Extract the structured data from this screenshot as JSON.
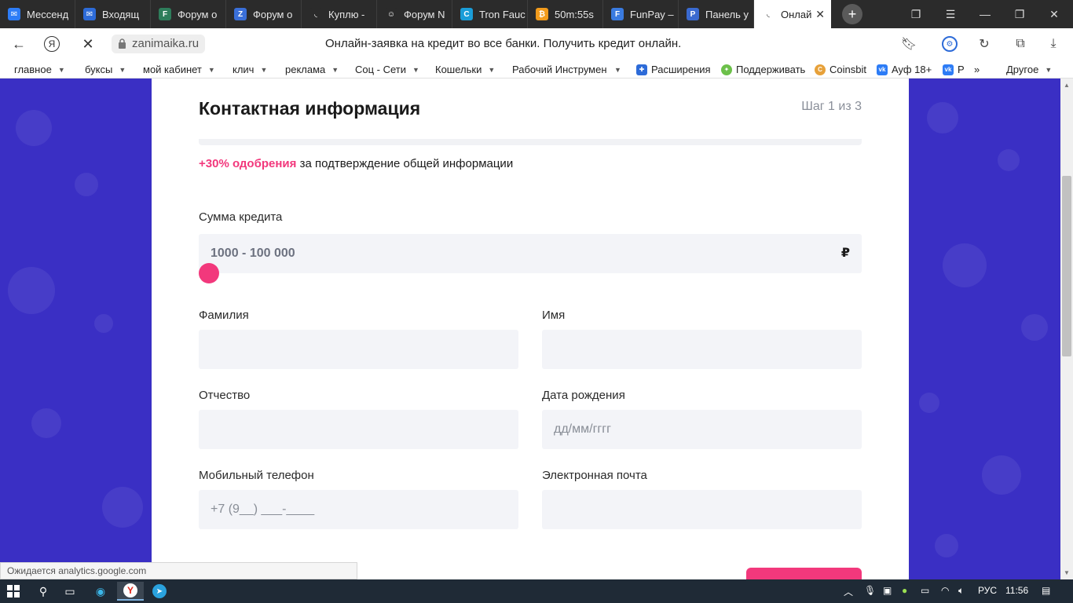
{
  "browser": {
    "tabs": [
      {
        "title": "Мессенд",
        "icon": "messenger-icon",
        "color": "#2d7cf6",
        "glyph": "✉"
      },
      {
        "title": "Входящ",
        "icon": "mail-icon",
        "color": "#2d6bd8",
        "glyph": "✉"
      },
      {
        "title": "Форум о",
        "icon": "forum-icon",
        "color": "#2e7d5b",
        "glyph": "F"
      },
      {
        "title": "Форум о",
        "icon": "zeta-forum-icon",
        "color": "#3a6fd8",
        "glyph": "Z"
      },
      {
        "title": "Куплю -",
        "icon": "loading-icon",
        "color": "#2b2b2b",
        "glyph": "◟"
      },
      {
        "title": "Форум N",
        "icon": "cat-forum-icon",
        "color": "#2b2b2b",
        "glyph": "☺"
      },
      {
        "title": "Tron Fauc",
        "icon": "tron-icon",
        "color": "#1a9dd8",
        "glyph": "C"
      },
      {
        "title": "50m:55s",
        "icon": "bitcoin-icon",
        "color": "#f29b1c",
        "glyph": "₿"
      },
      {
        "title": "FunPay –",
        "icon": "funpay-icon",
        "color": "#3a7be0",
        "glyph": "F"
      },
      {
        "title": "Панель у",
        "icon": "panel-icon",
        "color": "#3a6ad0",
        "glyph": "P"
      },
      {
        "title": "Онлай",
        "icon": "loading-icon",
        "color": "#ffffff",
        "glyph": "◟",
        "active": true
      }
    ],
    "url": "zanimaika.ru",
    "page_title": "Онлайн-заявка на кредит во все банки. Получить кредит онлайн.",
    "bookmarks": [
      {
        "label": "главное",
        "dropdown": true
      },
      {
        "label": "буксы",
        "dropdown": true
      },
      {
        "label": "мой кабинет",
        "dropdown": true
      },
      {
        "label": "клич",
        "dropdown": true
      },
      {
        "label": "реклама",
        "dropdown": true
      },
      {
        "label": "Соц - Сети",
        "dropdown": true
      },
      {
        "label": "Кошельки",
        "dropdown": true
      },
      {
        "label": "Рабочий Инструмен",
        "dropdown": true
      },
      {
        "label": "Расширения",
        "icon": "puzzle-icon"
      },
      {
        "label": "Поддерживать",
        "icon": "lightbulb-icon"
      },
      {
        "label": "Coinsbit",
        "icon": "coinsbit-icon"
      },
      {
        "label": "Ауф 18+",
        "icon": "vk-icon"
      },
      {
        "label": "Р",
        "icon": "vk-icon"
      }
    ],
    "more_bookmarks": "»",
    "other_bookmarks": "Другое",
    "status_text": "Ожидается analytics.google.com"
  },
  "form": {
    "title": "Контактная информация",
    "step": "Шаг 1 из 3",
    "approval_bonus": "+30% одобрения",
    "approval_text": " за подтверждение общей информации",
    "amount_label": "Сумма кредита",
    "amount_range": "1000 - 100 000",
    "currency": "₽",
    "last_name_label": "Фамилия",
    "first_name_label": "Имя",
    "patronymic_label": "Отчество",
    "birthdate_label": "Дата рождения",
    "birthdate_placeholder": "дд/мм/гггг",
    "phone_label": "Мобильный телефон",
    "phone_placeholder": "+7 (9__) ___-____",
    "email_label": "Электронная почта"
  },
  "taskbar": {
    "lang": "РУС",
    "time": "11:56"
  },
  "colors": {
    "accent": "#f2387c",
    "background": "#3a2fc4"
  }
}
